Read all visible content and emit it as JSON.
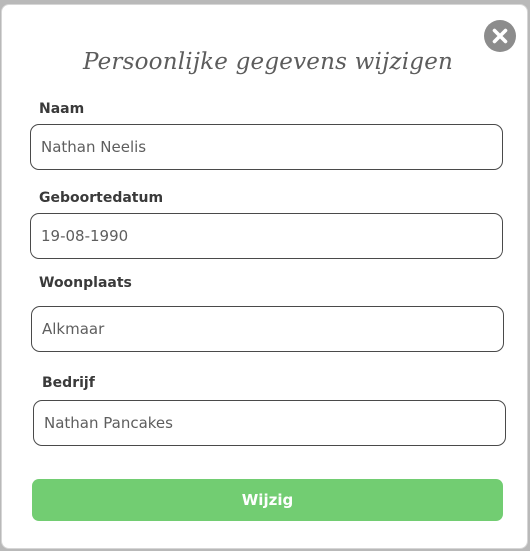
{
  "modal": {
    "title": "Persoonlijke gegevens wijzigen",
    "close_icon": "close-icon"
  },
  "form": {
    "fields": [
      {
        "label": "Naam",
        "value": "Nathan Neelis"
      },
      {
        "label": "Geboortedatum",
        "value": "19-08-1990"
      },
      {
        "label": "Woonplaats",
        "value": "Alkmaar"
      },
      {
        "label": "Bedrijf",
        "value": "Nathan Pancakes"
      }
    ],
    "submit_label": "Wijzig"
  },
  "colors": {
    "submit_button": "#72cd72",
    "close_button": "#8c8c8c",
    "input_border": "#4a4a4a"
  }
}
